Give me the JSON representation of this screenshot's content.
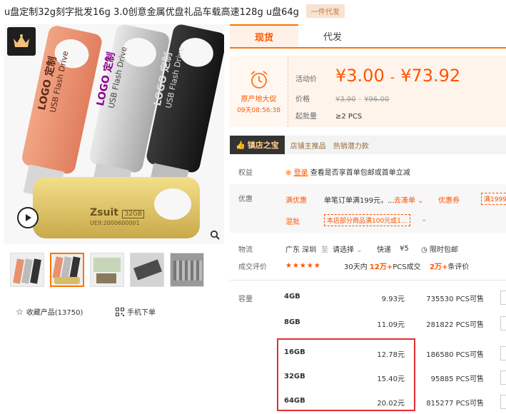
{
  "product": {
    "title": "u盘定制32g刻字批发16g 3.0创意金属优盘礼品车载高速128g u盘64g",
    "dropship_badge": "一件代发"
  },
  "gallery": {
    "image_text": {
      "logo_custom": "LOGO 定制",
      "usb_flash_drive": "USB Flash Drive",
      "gold_brand": "Zsuit",
      "gold_capacity": "32GB",
      "gold_serial": "UE9:2000600001"
    },
    "favorites_label": "收藏产品(13750)",
    "mobile_order_label": "手机下单"
  },
  "tabs": [
    {
      "label": "现货",
      "active": true
    },
    {
      "label": "代发",
      "active": false
    }
  ],
  "promo": {
    "label": "原产地大促",
    "countdown": "09天08:56:38"
  },
  "pricing": {
    "activity_label": "活动价",
    "activity_low": "¥3.00",
    "activity_sep": "-",
    "activity_high": "¥73.92",
    "price_label": "价格",
    "orig_low": "¥3.90",
    "orig_sep": "-",
    "orig_high": "¥96.00",
    "moq_label": "起批量",
    "moq_value": "≥2 PCS"
  },
  "shop_bar": {
    "tag": "镇店之宝",
    "links": [
      "店铺主推品",
      "热销潜力款"
    ]
  },
  "rights": {
    "label": "权益",
    "login_link": "登录",
    "text": "查看是否享首单包邮或首单立减"
  },
  "discount": {
    "label": "优惠",
    "full_reduce": "满优惠",
    "full_reduce_text": "单笔订单满199元，...",
    "full_reduce_link": "去凑单",
    "coupon": "优惠券",
    "coupon_chip": "满1999",
    "mixed": "混批",
    "mixed_chip": "本店部分商品满100元或1..."
  },
  "logistics": {
    "label": "物流",
    "from": "广东 深圳",
    "to_label": "至",
    "to": "请选择",
    "express": "快递",
    "fee": "¥5",
    "free_ship": "限时包邮"
  },
  "reviews": {
    "label": "成交评价",
    "stars": "★★★★★",
    "deals_prefix": "30天内",
    "deals_count": "12万+",
    "deals_suffix": "PCS成交",
    "reviews_count": "2万+",
    "reviews_suffix": "条评价"
  },
  "specs": {
    "label": "容量",
    "items": [
      {
        "name": "4GB",
        "price": "9.93元",
        "stock": "735530 PCS可售"
      },
      {
        "name": "8GB",
        "price": "11.09元",
        "stock": "281822 PCS可售"
      },
      {
        "name": "16GB",
        "price": "12.78元",
        "stock": "186580 PCS可售"
      },
      {
        "name": "32GB",
        "price": "15.40元",
        "stock": "95885 PCS可售"
      },
      {
        "name": "64GB",
        "price": "20.02元",
        "stock": "815277 PCS可售"
      }
    ]
  },
  "colors": {
    "accent": "#ff5500",
    "highlight_border": "#e03030"
  }
}
